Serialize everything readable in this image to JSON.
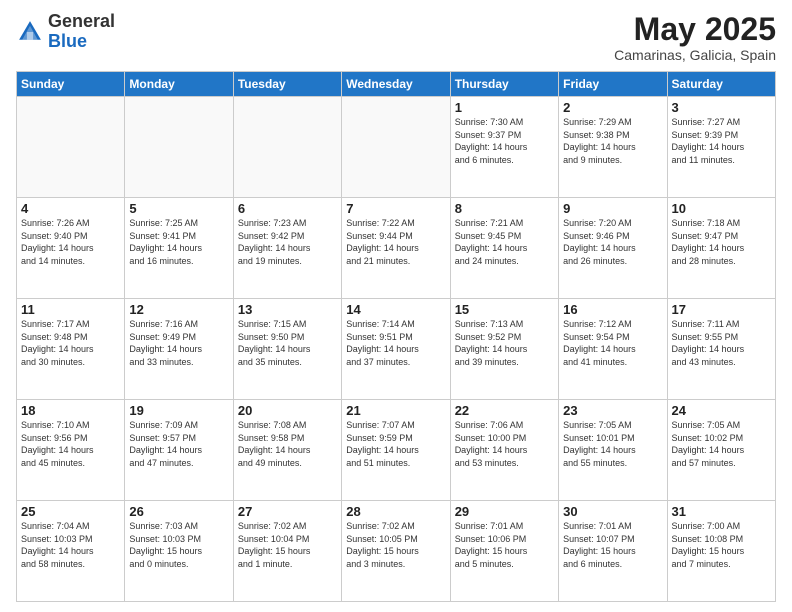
{
  "header": {
    "logo_general": "General",
    "logo_blue": "Blue",
    "month_title": "May 2025",
    "subtitle": "Camarinas, Galicia, Spain"
  },
  "weekdays": [
    "Sunday",
    "Monday",
    "Tuesday",
    "Wednesday",
    "Thursday",
    "Friday",
    "Saturday"
  ],
  "weeks": [
    [
      {
        "day": "",
        "info": ""
      },
      {
        "day": "",
        "info": ""
      },
      {
        "day": "",
        "info": ""
      },
      {
        "day": "",
        "info": ""
      },
      {
        "day": "1",
        "info": "Sunrise: 7:30 AM\nSunset: 9:37 PM\nDaylight: 14 hours\nand 6 minutes."
      },
      {
        "day": "2",
        "info": "Sunrise: 7:29 AM\nSunset: 9:38 PM\nDaylight: 14 hours\nand 9 minutes."
      },
      {
        "day": "3",
        "info": "Sunrise: 7:27 AM\nSunset: 9:39 PM\nDaylight: 14 hours\nand 11 minutes."
      }
    ],
    [
      {
        "day": "4",
        "info": "Sunrise: 7:26 AM\nSunset: 9:40 PM\nDaylight: 14 hours\nand 14 minutes."
      },
      {
        "day": "5",
        "info": "Sunrise: 7:25 AM\nSunset: 9:41 PM\nDaylight: 14 hours\nand 16 minutes."
      },
      {
        "day": "6",
        "info": "Sunrise: 7:23 AM\nSunset: 9:42 PM\nDaylight: 14 hours\nand 19 minutes."
      },
      {
        "day": "7",
        "info": "Sunrise: 7:22 AM\nSunset: 9:44 PM\nDaylight: 14 hours\nand 21 minutes."
      },
      {
        "day": "8",
        "info": "Sunrise: 7:21 AM\nSunset: 9:45 PM\nDaylight: 14 hours\nand 24 minutes."
      },
      {
        "day": "9",
        "info": "Sunrise: 7:20 AM\nSunset: 9:46 PM\nDaylight: 14 hours\nand 26 minutes."
      },
      {
        "day": "10",
        "info": "Sunrise: 7:18 AM\nSunset: 9:47 PM\nDaylight: 14 hours\nand 28 minutes."
      }
    ],
    [
      {
        "day": "11",
        "info": "Sunrise: 7:17 AM\nSunset: 9:48 PM\nDaylight: 14 hours\nand 30 minutes."
      },
      {
        "day": "12",
        "info": "Sunrise: 7:16 AM\nSunset: 9:49 PM\nDaylight: 14 hours\nand 33 minutes."
      },
      {
        "day": "13",
        "info": "Sunrise: 7:15 AM\nSunset: 9:50 PM\nDaylight: 14 hours\nand 35 minutes."
      },
      {
        "day": "14",
        "info": "Sunrise: 7:14 AM\nSunset: 9:51 PM\nDaylight: 14 hours\nand 37 minutes."
      },
      {
        "day": "15",
        "info": "Sunrise: 7:13 AM\nSunset: 9:52 PM\nDaylight: 14 hours\nand 39 minutes."
      },
      {
        "day": "16",
        "info": "Sunrise: 7:12 AM\nSunset: 9:54 PM\nDaylight: 14 hours\nand 41 minutes."
      },
      {
        "day": "17",
        "info": "Sunrise: 7:11 AM\nSunset: 9:55 PM\nDaylight: 14 hours\nand 43 minutes."
      }
    ],
    [
      {
        "day": "18",
        "info": "Sunrise: 7:10 AM\nSunset: 9:56 PM\nDaylight: 14 hours\nand 45 minutes."
      },
      {
        "day": "19",
        "info": "Sunrise: 7:09 AM\nSunset: 9:57 PM\nDaylight: 14 hours\nand 47 minutes."
      },
      {
        "day": "20",
        "info": "Sunrise: 7:08 AM\nSunset: 9:58 PM\nDaylight: 14 hours\nand 49 minutes."
      },
      {
        "day": "21",
        "info": "Sunrise: 7:07 AM\nSunset: 9:59 PM\nDaylight: 14 hours\nand 51 minutes."
      },
      {
        "day": "22",
        "info": "Sunrise: 7:06 AM\nSunset: 10:00 PM\nDaylight: 14 hours\nand 53 minutes."
      },
      {
        "day": "23",
        "info": "Sunrise: 7:05 AM\nSunset: 10:01 PM\nDaylight: 14 hours\nand 55 minutes."
      },
      {
        "day": "24",
        "info": "Sunrise: 7:05 AM\nSunset: 10:02 PM\nDaylight: 14 hours\nand 57 minutes."
      }
    ],
    [
      {
        "day": "25",
        "info": "Sunrise: 7:04 AM\nSunset: 10:03 PM\nDaylight: 14 hours\nand 58 minutes."
      },
      {
        "day": "26",
        "info": "Sunrise: 7:03 AM\nSunset: 10:03 PM\nDaylight: 15 hours\nand 0 minutes."
      },
      {
        "day": "27",
        "info": "Sunrise: 7:02 AM\nSunset: 10:04 PM\nDaylight: 15 hours\nand 1 minute."
      },
      {
        "day": "28",
        "info": "Sunrise: 7:02 AM\nSunset: 10:05 PM\nDaylight: 15 hours\nand 3 minutes."
      },
      {
        "day": "29",
        "info": "Sunrise: 7:01 AM\nSunset: 10:06 PM\nDaylight: 15 hours\nand 5 minutes."
      },
      {
        "day": "30",
        "info": "Sunrise: 7:01 AM\nSunset: 10:07 PM\nDaylight: 15 hours\nand 6 minutes."
      },
      {
        "day": "31",
        "info": "Sunrise: 7:00 AM\nSunset: 10:08 PM\nDaylight: 15 hours\nand 7 minutes."
      }
    ]
  ]
}
